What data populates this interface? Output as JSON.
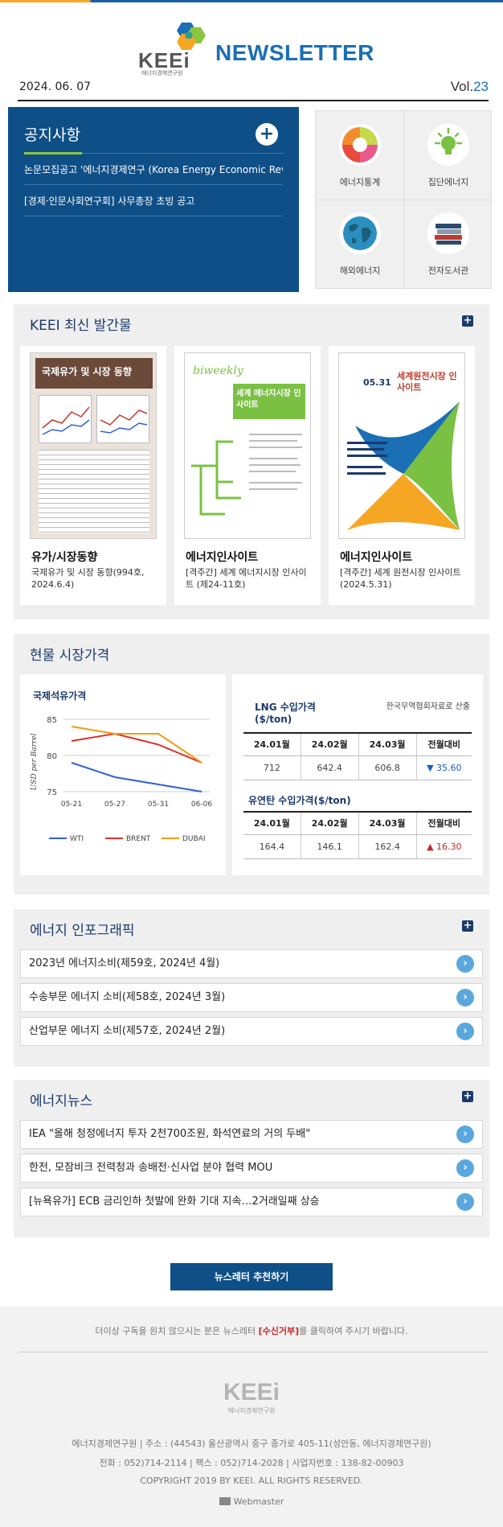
{
  "header": {
    "logo_text": "KEEi",
    "logo_sub": "에너지경제연구원",
    "title": "NEWSLETTER",
    "date": "2024. 06. 07",
    "vol_prefix": "Vol.",
    "vol_number": "23"
  },
  "notice": {
    "title": "공지사항",
    "items": [
      "논문모집공고 '에너지경제연구 (Korea Energy Economic Review",
      "[경제·인문사회연구회] 사무총장 초빙 공고"
    ]
  },
  "quick_links": [
    {
      "label": "에너지통계",
      "icon": "pie-chart-icon"
    },
    {
      "label": "집단에너지",
      "icon": "light-bulb-icon"
    },
    {
      "label": "해외에너지",
      "icon": "globe-icon"
    },
    {
      "label": "전자도서관",
      "icon": "books-icon"
    }
  ],
  "publications": {
    "title": "KEEI 최신 발간물",
    "items": [
      {
        "title": "유가/시장동향",
        "desc": "국제유가 및 시장 동향(994호, 2024.6.4)",
        "cover_text": "국제유가 및 시장 동향"
      },
      {
        "title": "에너지인사이트",
        "desc": "[격주간] 세계 에너지시장 인사이트 (제24-11호)",
        "cover_text": "세계 에너지시장 인사이트",
        "cover_sub": "biweekly"
      },
      {
        "title": "에너지인사이트",
        "desc": "[격주간] 세계 원전시장 인사이트(2024.5.31)",
        "cover_text": "세계원전시장 인사이트",
        "cover_date": "05.31"
      }
    ]
  },
  "market": {
    "title": "현물 시장가격",
    "oil_title": "국제석유가격",
    "lng_title": "LNG 수입가격 ($/ton)",
    "lng_source": "한국무역협회자료로 산출",
    "lng_headers": [
      "24.01월",
      "24.02월",
      "24.03월",
      "전월대비"
    ],
    "lng_values": [
      "712",
      "642.4",
      "606.8",
      "▼ 35.60"
    ],
    "coal_title": "유연탄 수입가격($/ton)",
    "coal_headers": [
      "24.01월",
      "24.02월",
      "24.03월",
      "전월대비"
    ],
    "coal_values": [
      "164.4",
      "146.1",
      "162.4",
      "▲ 16.30"
    ]
  },
  "chart_data": {
    "type": "line",
    "title": "국제석유가격",
    "ylabel": "USD per Barrel",
    "categories": [
      "05-21",
      "05-27",
      "05-31",
      "06-06"
    ],
    "ylim": [
      75,
      85
    ],
    "yticks": [
      "85",
      "80",
      "75"
    ],
    "series": [
      {
        "name": "WTI",
        "color": "#2f5fd0",
        "values": [
          79.0,
          77.0,
          76.0,
          75.0
        ]
      },
      {
        "name": "BRENT",
        "color": "#d9332b",
        "values": [
          82.0,
          83.0,
          81.5,
          79.0
        ]
      },
      {
        "name": "DUBAI",
        "color": "#f39c12",
        "values": [
          84.0,
          83.0,
          83.0,
          79.0
        ]
      }
    ]
  },
  "infographic": {
    "title": "에너지 인포그래픽",
    "items": [
      "2023년 에너지소비(제59호, 2024년 4월)",
      "수송부문 에너지 소비(제58호, 2024년 3월)",
      "산업부문 에너지 소비(제57호, 2024년 2월)"
    ]
  },
  "news": {
    "title": "에너지뉴스",
    "items": [
      "IEA \"올해 청정에너지 투자 2천700조원, 화석연료의 거의 두배\"",
      "한전, 모잠비크 전력청과 송배전·신사업 분야 협력 MOU",
      "[뉴욕유가] ECB 금리인하 첫발에 완화 기대 지속…2거래일째 상승"
    ]
  },
  "recommend_label": "뉴스레터 추천하기",
  "footer": {
    "unsub_prefix": "더이상 구독을 원치 않으시는 분은 뉴스레터",
    "unsub_link": "[수신거부]",
    "unsub_suffix": "를 클릭하여 주시기 바랍니다.",
    "logo_text": "KEEi",
    "logo_sub": "에너지경제연구원",
    "address": "에너지경제연구원 | 주소 : (44543) 울산광역시 중구 종가로 405-11(성안동, 에너지경제연구원)",
    "contact": "전화 : 052)714-2114 | 팩스 : 052)714-2028 | 사업자번호 : 138-82-00903",
    "copyright": "COPYRIGHT 2019 BY KEEI. ALL RIGHTS RESERVED.",
    "webmaster": "Webmaster"
  }
}
